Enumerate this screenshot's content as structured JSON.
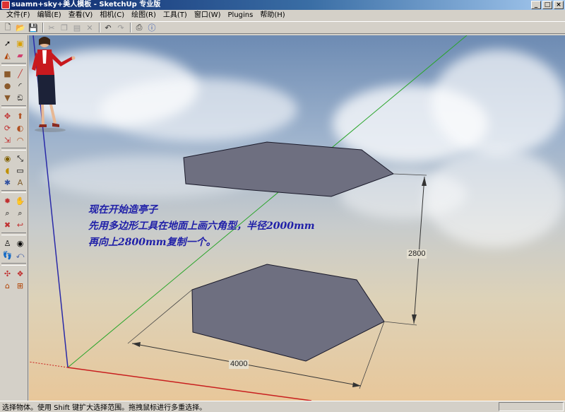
{
  "window": {
    "title": "suamn+sky+美人模板 - SketchUp 专业版"
  },
  "menu": [
    "文件(F)",
    "编辑(E)",
    "查看(V)",
    "相机(C)",
    "绘图(R)",
    "工具(T)",
    "窗口(W)",
    "Plugins",
    "帮助(H)"
  ],
  "toolbar_icons": [
    "new-icon",
    "open-icon",
    "save-icon",
    "cut-icon",
    "copy-icon",
    "paste-icon",
    "delete-icon",
    "undo-icon",
    "redo-icon",
    "print-icon",
    "info-icon"
  ],
  "palette_icons": [
    [
      "select-icon",
      "make-component-icon"
    ],
    [
      "paint-bucket-icon",
      "eraser-icon"
    ],
    [
      "rectangle-icon",
      "line-icon"
    ],
    [
      "circle-icon",
      "arc-icon"
    ],
    [
      "polygon-icon",
      "freehand-icon"
    ],
    [
      "move-icon",
      "push-pull-icon"
    ],
    [
      "rotate-icon",
      "follow-me-icon"
    ],
    [
      "scale-icon",
      "offset-icon"
    ],
    [
      "tape-measure-icon",
      "dimension-icon"
    ],
    [
      "protractor-icon",
      "text-icon"
    ],
    [
      "axes-icon",
      "3d-text-icon"
    ],
    [
      "orbit-icon",
      "pan-icon"
    ],
    [
      "zoom-icon",
      "zoom-window-icon"
    ],
    [
      "zoom-extents-icon",
      "previous-view-icon"
    ],
    [
      "position-camera-icon",
      "look-around-icon"
    ],
    [
      "walk-icon",
      "section-plane-icon"
    ],
    [
      "sandbox-icon",
      "stamp-icon"
    ],
    [
      "smoove-icon",
      "drape-icon"
    ]
  ],
  "caption": {
    "line1": "现在开始造亭子",
    "line2": "先用多边形工具在地面上画六角型，半径2000mm",
    "line3": "再向上2800mm复制一个。"
  },
  "dimensions": {
    "height": "2800",
    "width": "4000"
  },
  "status": {
    "text": "选择物体。使用 Shift 键扩大选择范围。拖拽鼠标进行多重选择。"
  }
}
